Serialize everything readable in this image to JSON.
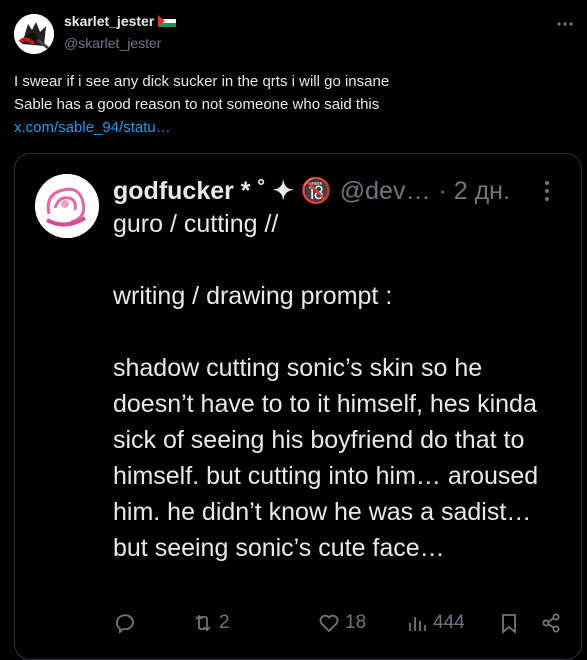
{
  "post": {
    "display_name": "skarlet_jester",
    "handle": "@skarlet_jester",
    "text_lines": [
      "I swear if i see any dick sucker in the qrts i will go insane",
      "Sable has a good reason to not someone who said this"
    ],
    "link": "x.com/sable_94/statu…",
    "flag_icon": "palestine-flag-icon",
    "more_icon": "more-horizontal-icon"
  },
  "quote": {
    "display_name": "godfucker * ˚ ✦ 🔞",
    "handle": "@dev…",
    "time": "· 2 дн.",
    "paragraphs": [
      "guro / cutting //",
      "writing / drawing prompt :",
      "shadow cutting sonic’s skin so he doesn’t have to to it himself, hes kinda sick of seeing his boyfriend do that to himself. but cutting into him… aroused him. he didn’t know he was a sadist… but seeing sonic’s cute face…"
    ],
    "actions": {
      "reply_count": "",
      "repost_count": "2",
      "like_count": "18",
      "views_count": "444"
    }
  },
  "colors": {
    "background": "#000000",
    "text": "#e7e9ea",
    "muted": "#71767b",
    "link": "#1d9bf0",
    "border": "#2f3336"
  }
}
